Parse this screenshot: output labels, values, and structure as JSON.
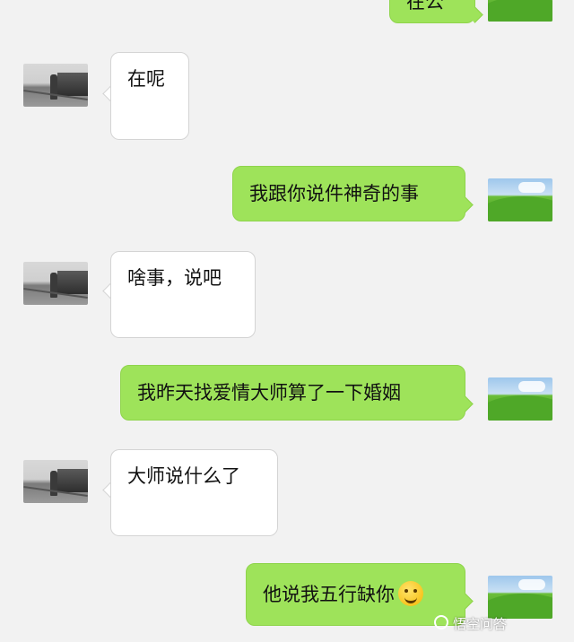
{
  "chat": {
    "messages": [
      {
        "side": "out",
        "text": "在公"
      },
      {
        "side": "in",
        "text": "在呢"
      },
      {
        "side": "out",
        "text": "我跟你说件神奇的事"
      },
      {
        "side": "in",
        "text": "啥事，说吧"
      },
      {
        "side": "out",
        "text": "我昨天找爱情大师算了一下婚姻"
      },
      {
        "side": "in",
        "text": "大师说什么了"
      },
      {
        "side": "out",
        "text": "他说我五行缺你",
        "emoji": "hugging-face-emoji"
      }
    ]
  },
  "watermark": {
    "text": "悟空问答"
  },
  "colors": {
    "outgoing_bubble": "#9ee35a",
    "incoming_bubble": "#ffffff",
    "background": "#f2f2f2"
  }
}
